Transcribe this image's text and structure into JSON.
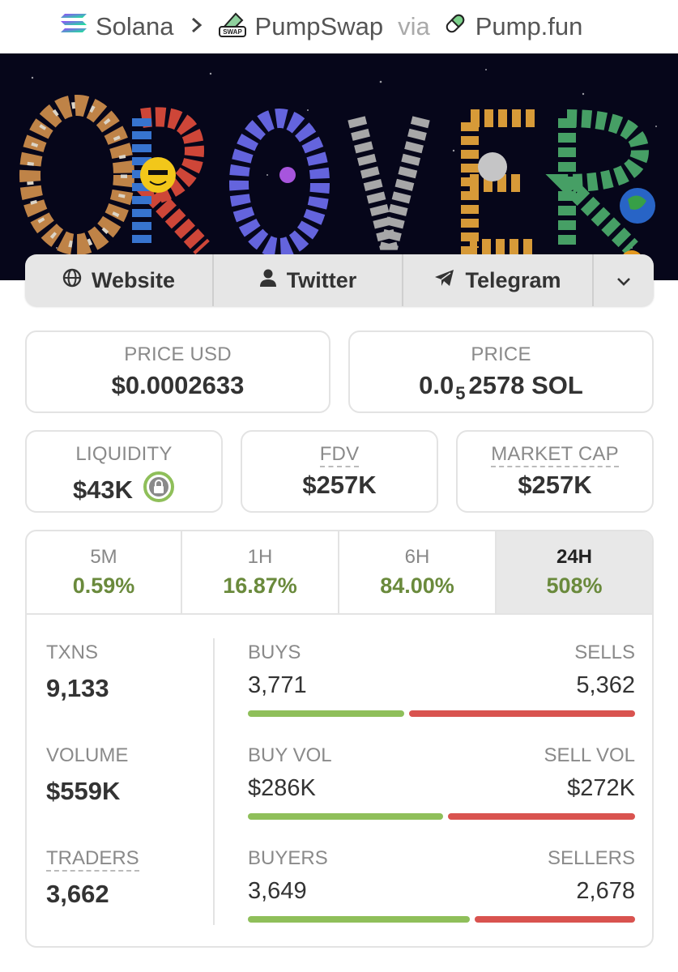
{
  "breadcrumb": {
    "chain": "Solana",
    "dex": "PumpSwap",
    "via": "via",
    "launchpad": "Pump.fun",
    "dex_icon_text": "SWAP"
  },
  "socials": {
    "website": "Website",
    "twitter": "Twitter",
    "telegram": "Telegram"
  },
  "price": {
    "usd_label": "PRICE USD",
    "usd_value": "$0.0002633",
    "native_label": "PRICE",
    "native_prefix": "0.0",
    "native_zeros": "5",
    "native_digits": "2578 SOL"
  },
  "metrics": {
    "liquidity_label": "LIQUIDITY",
    "liquidity_value": "$43K",
    "fdv_label": "FDV",
    "fdv_value": "$257K",
    "mcap_label": "MARKET CAP",
    "mcap_value": "$257K"
  },
  "timeframes": [
    {
      "label": "5M",
      "change": "0.59%"
    },
    {
      "label": "1H",
      "change": "16.87%"
    },
    {
      "label": "6H",
      "change": "84.00%"
    },
    {
      "label": "24H",
      "change": "508%"
    }
  ],
  "stats": {
    "txns_label": "TXNS",
    "txns_value": "9,133",
    "volume_label": "VOLUME",
    "volume_value": "$559K",
    "traders_label": "TRADERS",
    "traders_value": "3,662",
    "buys_label": "BUYS",
    "buys_value": "3,771",
    "sells_label": "SELLS",
    "sells_value": "5,362",
    "buy_vol_label": "BUY VOL",
    "buy_vol_value": "$286K",
    "sell_vol_label": "SELL VOL",
    "sell_vol_value": "$272K",
    "buyers_label": "BUYERS",
    "buyers_value": "3,649",
    "sellers_label": "SELLERS",
    "sellers_value": "2,678",
    "buys_share": 0.41,
    "buy_vol_share": 0.51,
    "buyers_share": 0.58
  },
  "colors": {
    "positive": "#6a8a3c",
    "buy_bar": "#8fbf5a",
    "sell_bar": "#d9534f",
    "banner_bg": "#06061a"
  },
  "icons": [
    "solana-icon",
    "chevron-right-icon",
    "pumpswap-icon",
    "pill-icon",
    "globe-icon",
    "user-icon",
    "telegram-icon",
    "chevron-down-icon",
    "lock-icon"
  ]
}
